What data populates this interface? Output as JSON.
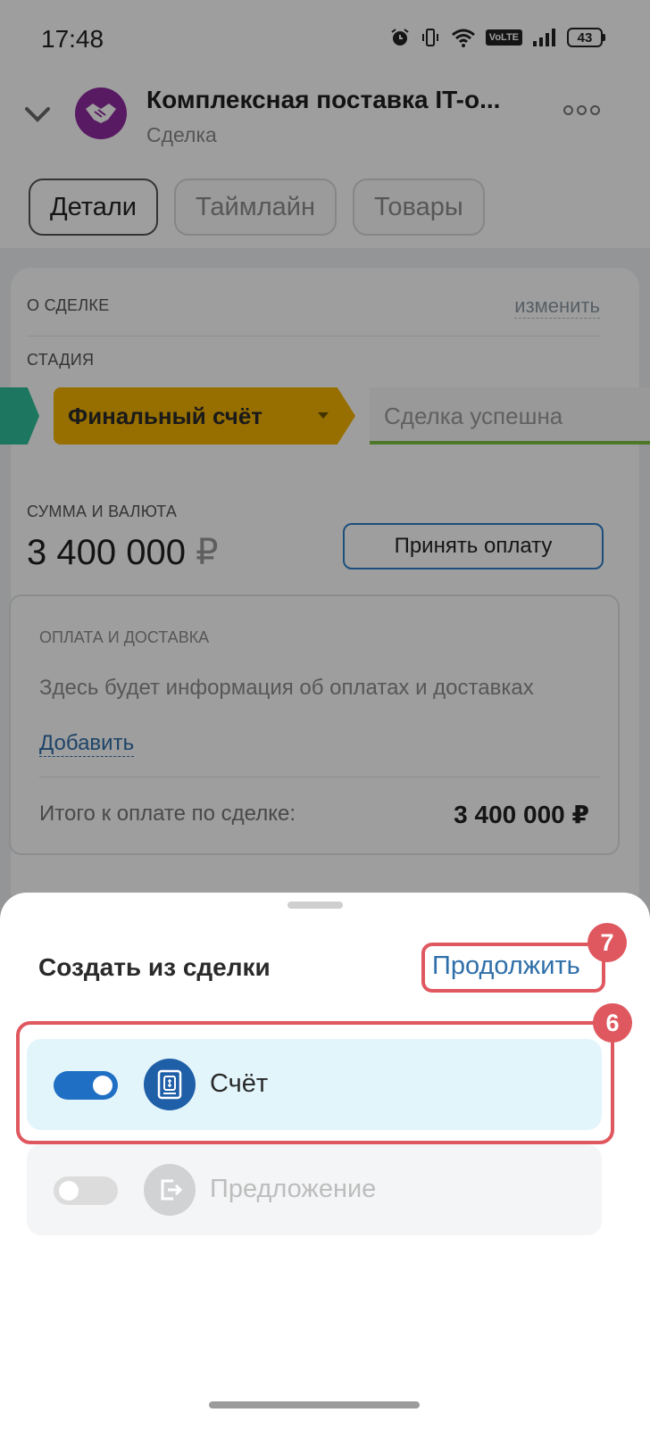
{
  "status_bar": {
    "time": "17:48",
    "network": "VoLTE",
    "battery": "43",
    "icons": [
      "alarm-icon",
      "vibrate-icon",
      "wifi-icon",
      "volte-icon",
      "signal-icon",
      "battery-icon"
    ]
  },
  "header": {
    "title": "Комплексная поставка IT-о...",
    "subtitle": "Сделка",
    "avatar_icon": "handshake-icon",
    "avatar_color": "#8e2b9e"
  },
  "tabs": [
    {
      "label": "Детали",
      "active": true
    },
    {
      "label": "Таймлайн",
      "active": false
    },
    {
      "label": "Товары",
      "active": false
    }
  ],
  "about": {
    "section_label": "О СДЕЛКЕ",
    "edit_label": "изменить",
    "stage_label": "СТАДИЯ",
    "stage_current": "Финальный счёт",
    "stage_next": "Сделка успешна",
    "stage_colors": {
      "previous": "#2fbf9b",
      "current": "#f4b400",
      "next_underline": "#7dc242"
    }
  },
  "amount": {
    "label": "СУММА И ВАЛЮТА",
    "value": "3 400 000",
    "currency": "₽",
    "accept_button": "Принять оплату"
  },
  "payment": {
    "label": "ОПЛАТА И ДОСТАВКА",
    "info": "Здесь будет информация об оплатах и доставках",
    "add_link": "Добавить",
    "total_label": "Итого к оплате по сделке:",
    "total_value": "3 400 000 ₽"
  },
  "sheet": {
    "title": "Создать из сделки",
    "continue_label": "Продолжить",
    "options": [
      {
        "label": "Счёт",
        "enabled": true,
        "icon": "invoice-icon"
      },
      {
        "label": "Предложение",
        "enabled": false,
        "icon": "offer-export-icon"
      }
    ]
  },
  "annotations": {
    "continue_step": "7",
    "invoice_step": "6",
    "highlight_color": "#e0585f"
  }
}
